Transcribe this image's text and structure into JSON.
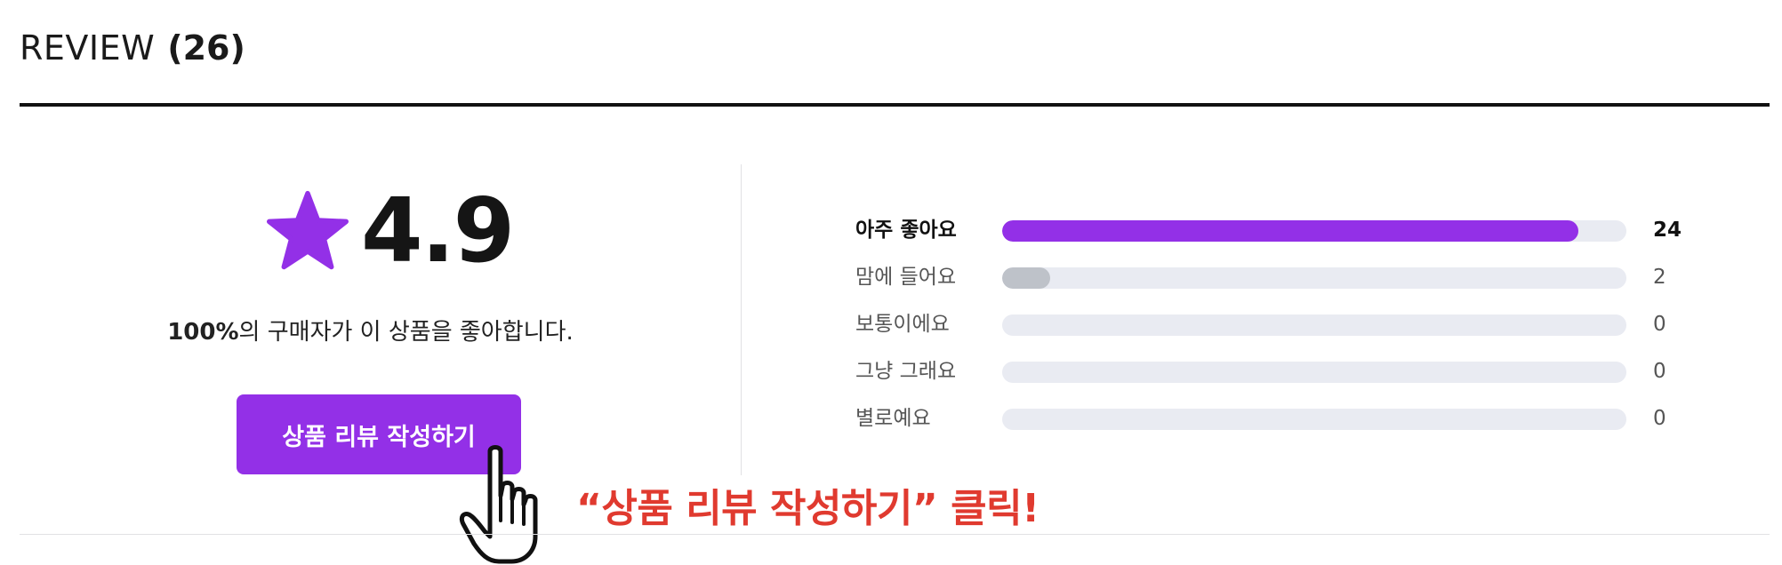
{
  "header": {
    "title": "REVIEW",
    "count": "(26)"
  },
  "summary": {
    "score": "4.9",
    "percent": "100%",
    "satisfaction_text": "의 구매자가 이 상품을 좋아합니다.",
    "star_color": "#9330e7"
  },
  "write_button": {
    "label": "상품 리뷰 작성하기",
    "color": "#9330e7"
  },
  "callout": {
    "text": "“상품 리뷰 작성하기” 클릭!",
    "color": "#e03a2f"
  },
  "ratings": [
    {
      "label": "아주 좋아요",
      "count": "24",
      "fraction": 0.923,
      "bar_color": "#9330e7",
      "emphasized": true
    },
    {
      "label": "맘에 들어요",
      "count": "2",
      "fraction": 0.077,
      "bar_color": "#bec2c9",
      "emphasized": false
    },
    {
      "label": "보통이에요",
      "count": "0",
      "fraction": 0,
      "bar_color": "#bec2c9",
      "emphasized": false
    },
    {
      "label": "그냥 그래요",
      "count": "0",
      "fraction": 0,
      "bar_color": "#bec2c9",
      "emphasized": false
    },
    {
      "label": "별로예요",
      "count": "0",
      "fraction": 0,
      "bar_color": "#bec2c9",
      "emphasized": false
    }
  ]
}
